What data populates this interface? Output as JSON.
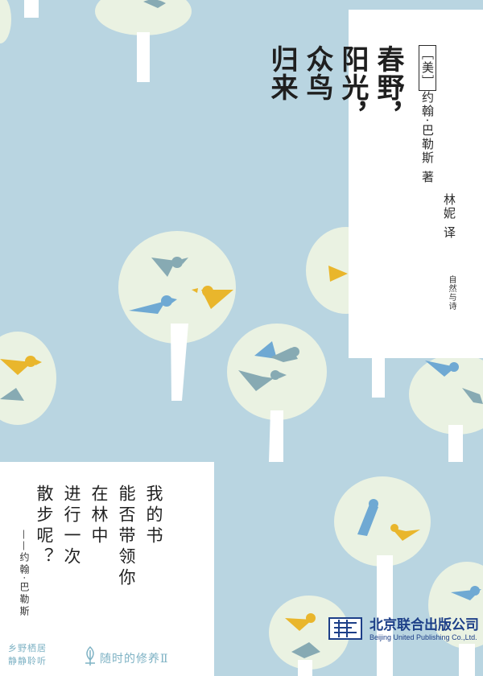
{
  "cover": {
    "title_lines": [
      "春野，",
      "阳光，",
      "众鸟",
      "归来"
    ],
    "author_origin": "［美］",
    "author_name": "约翰·巴勒斯",
    "author_role": "著",
    "translator_name": "林妮",
    "translator_role": "译",
    "series_name": "自然与诗"
  },
  "quote": {
    "lines": [
      "我的书",
      "能否带领你",
      "在林中",
      "进行一次",
      "散步呢？"
    ],
    "dash": "——",
    "author": "约翰·巴勒斯"
  },
  "footer": {
    "tagline_line1": "乡野栖居",
    "tagline_line2": "静静聆听",
    "series": "随时的修养Ⅱ"
  },
  "publisher": {
    "name": "北京联合出版公司",
    "name_en": "Beijing United Publishing Co.,Ltd."
  },
  "colors": {
    "background": "#b9d5e1",
    "tree_canopy": "#eaf2e2",
    "trunk": "#ffffff",
    "bird_blue": "#6fa9d3",
    "bird_gray": "#87aab3",
    "bird_yellow": "#e9b62c",
    "publisher_blue": "#1d3f88"
  }
}
